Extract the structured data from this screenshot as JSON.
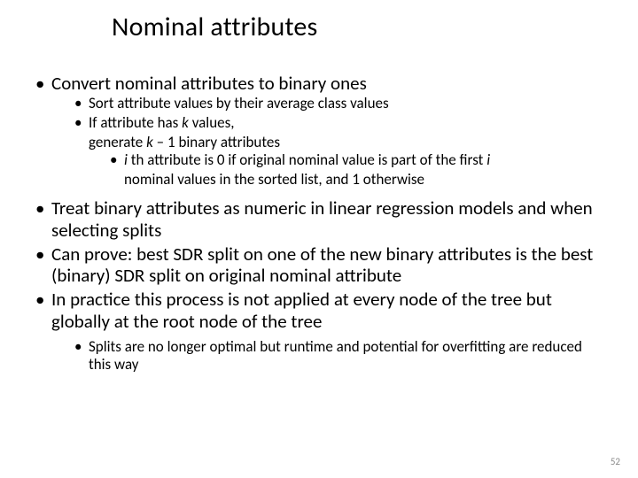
{
  "title": "Nominal attributes",
  "bullets": {
    "b1": "Convert nominal attributes to binary ones",
    "b1a": "Sort attribute values by their average class values",
    "b1b_pre": "If attribute has ",
    "b1b_k": "k",
    "b1b_post": " values,",
    "b1b_line2_pre": "generate ",
    "b1b_line2_k": "k",
    "b1b_line2_post": " – 1 binary attributes",
    "b1c_i": "i ",
    "b1c_mid": "th attribute is 0 if original nominal value is part of the first ",
    "b1c_i2": "i",
    "b1c_line2": "nominal values in the sorted list, and 1 otherwise",
    "b2": "Treat binary attributes as numeric in linear regression models and when selecting splits",
    "b3": "Can prove: best SDR split on one of the new binary attributes is the best (binary) SDR split on original nominal attribute",
    "b4": "In practice this process is not applied at every node of the tree but globally at the root node of the tree",
    "b4a": "Splits are no longer optimal but runtime and potential for overfitting are reduced this way"
  },
  "page_number": "52"
}
